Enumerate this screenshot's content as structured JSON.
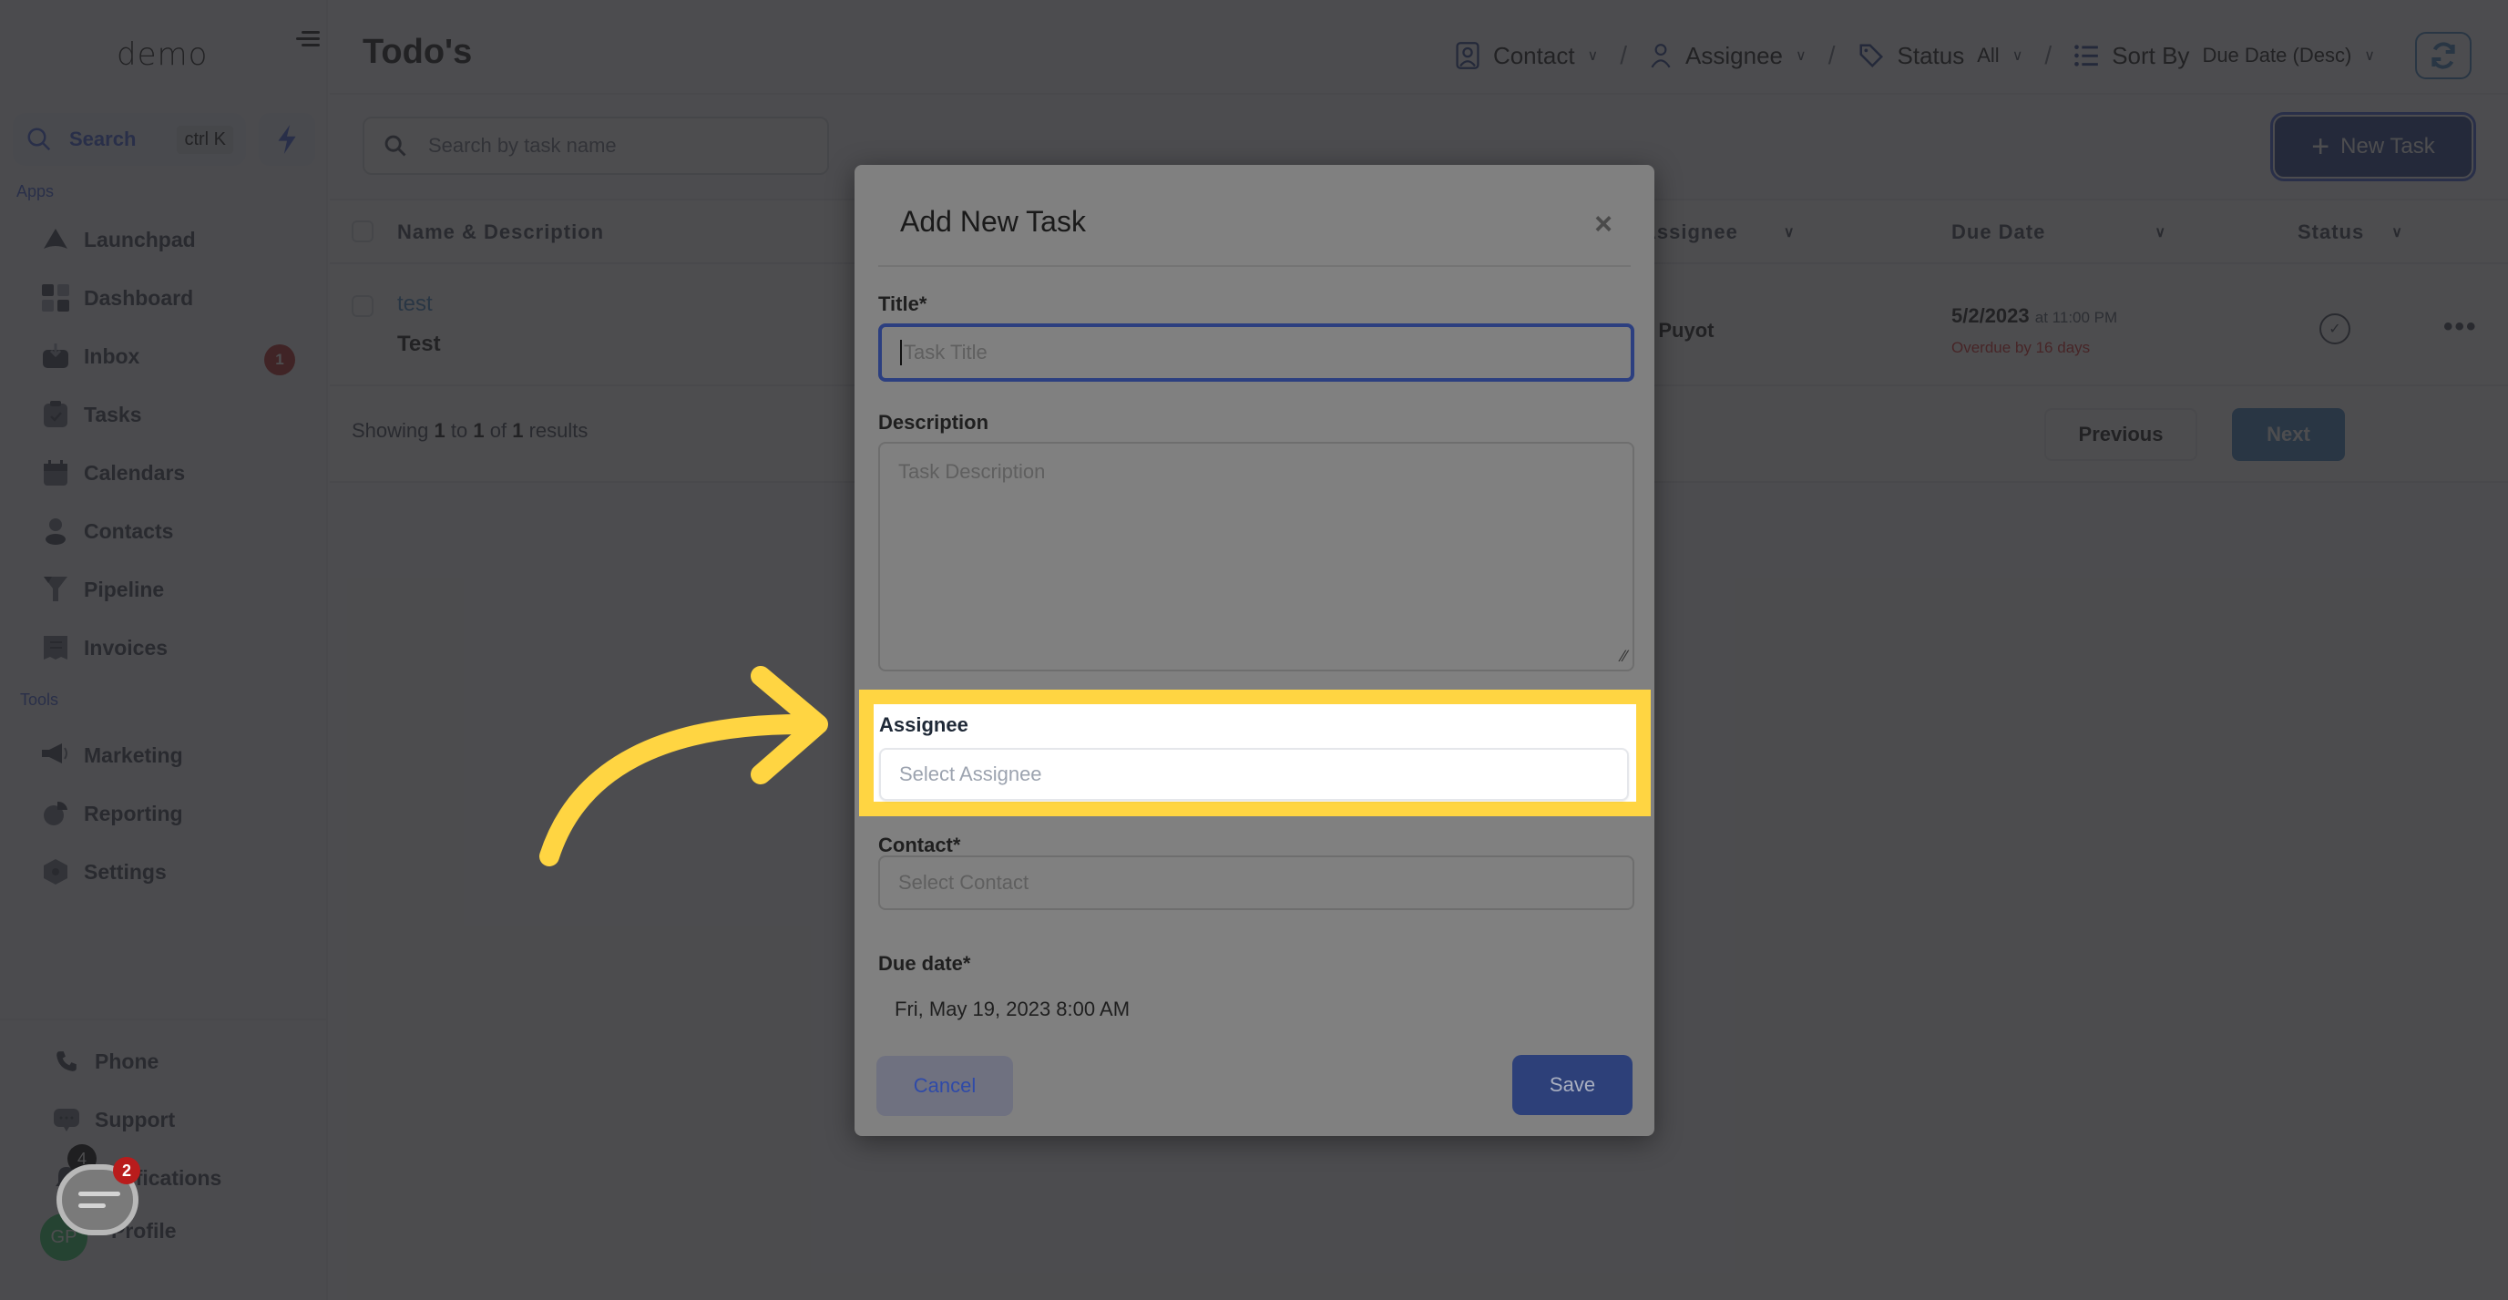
{
  "brand": {
    "logo": "demo"
  },
  "sidebar": {
    "search_label": "Search",
    "search_shortcut": "ctrl K",
    "apps_label": "Apps",
    "tools_label": "Tools",
    "apps": [
      {
        "label": "Launchpad",
        "icon": "rocket-icon"
      },
      {
        "label": "Dashboard",
        "icon": "grid-icon"
      },
      {
        "label": "Inbox",
        "icon": "inbox-icon",
        "badge": "1"
      },
      {
        "label": "Tasks",
        "icon": "clipboard-check-icon"
      },
      {
        "label": "Calendars",
        "icon": "calendar-icon"
      },
      {
        "label": "Contacts",
        "icon": "person-icon"
      },
      {
        "label": "Pipeline",
        "icon": "funnel-icon"
      },
      {
        "label": "Invoices",
        "icon": "receipt-icon"
      }
    ],
    "tools": [
      {
        "label": "Marketing",
        "icon": "megaphone-icon"
      },
      {
        "label": "Reporting",
        "icon": "pie-chart-icon"
      },
      {
        "label": "Settings",
        "icon": "gear-icon"
      }
    ],
    "bottom": [
      {
        "label": "Phone",
        "icon": "phone-icon"
      },
      {
        "label": "Support",
        "icon": "chat-bubble-icon"
      },
      {
        "label": "Notifications",
        "icon": "bell-icon",
        "badge": "4"
      },
      {
        "label": "Profile",
        "icon": "avatar",
        "initials": "GP"
      }
    ],
    "chat_badge": "2"
  },
  "header": {
    "title": "Todo's",
    "filters": {
      "contact": "Contact",
      "assignee": "Assignee",
      "status_label": "Status",
      "status_value": "All",
      "sort_label": "Sort By",
      "sort_value": "Due Date (Desc)"
    },
    "separator": "/"
  },
  "toolbar": {
    "search_placeholder": "Search by task name",
    "new_task_label": "New Task"
  },
  "table": {
    "columns": [
      "Name & Description",
      "Assignee",
      "Due Date",
      "Status"
    ],
    "rows": [
      {
        "title": "test",
        "description": "Test",
        "assignee": "e Puyot",
        "due_date": "5/2/2023",
        "due_time": "at 11:00 PM",
        "overdue": "Overdue by 16 days"
      }
    ],
    "showing_prefix": "Showing",
    "showing_from": "1",
    "showing_to_word": "to",
    "showing_to": "1",
    "showing_of_word": "of",
    "showing_total": "1",
    "showing_suffix": "results",
    "previous_label": "Previous",
    "next_label": "Next"
  },
  "modal": {
    "title": "Add New Task",
    "close_glyph": "×",
    "title_label": "Title*",
    "title_placeholder": "Task Title",
    "description_label": "Description",
    "description_placeholder": "Task Description",
    "assignee_label": "Assignee",
    "assignee_placeholder": "Select Assignee",
    "contact_label": "Contact*",
    "contact_placeholder": "Select Contact",
    "due_label": "Due date*",
    "due_value": "Fri, May 19, 2023 8:00 AM",
    "cancel_label": "Cancel",
    "save_label": "Save"
  },
  "annotation": {
    "highlight_color": "#ffd542",
    "arrow_color": "#ffd542"
  }
}
